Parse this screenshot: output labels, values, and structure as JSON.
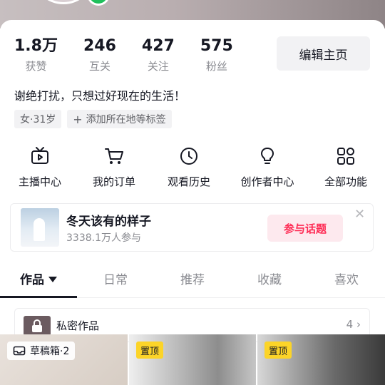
{
  "stats": [
    {
      "value": "1.8万",
      "label": "获赞"
    },
    {
      "value": "246",
      "label": "互关"
    },
    {
      "value": "427",
      "label": "关注"
    },
    {
      "value": "575",
      "label": "粉丝"
    }
  ],
  "edit_button": "编辑主页",
  "bio": "谢绝打扰，只想过好现在的生活！",
  "tags": {
    "gender_age": "女·31岁",
    "add_location": "添加所在地等标签"
  },
  "tools": [
    {
      "label": "主播中心",
      "icon": "tv-icon"
    },
    {
      "label": "我的订单",
      "icon": "cart-icon"
    },
    {
      "label": "观看历史",
      "icon": "clock-icon"
    },
    {
      "label": "创作者中心",
      "icon": "bulb-icon"
    },
    {
      "label": "全部功能",
      "icon": "grid-icon"
    }
  ],
  "topic": {
    "title": "冬天该有的样子",
    "subtitle": "3338.1万人参与",
    "button": "参与话题"
  },
  "tabs": [
    "作品",
    "日常",
    "推荐",
    "收藏",
    "喜欢"
  ],
  "private_works": {
    "label": "私密作品",
    "count": "4"
  },
  "grid": {
    "draft": "草稿箱·2",
    "pinned": "置顶"
  },
  "colors": {
    "accent": "#fe2c55",
    "pin": "#fcd428",
    "online": "#20c05c"
  }
}
